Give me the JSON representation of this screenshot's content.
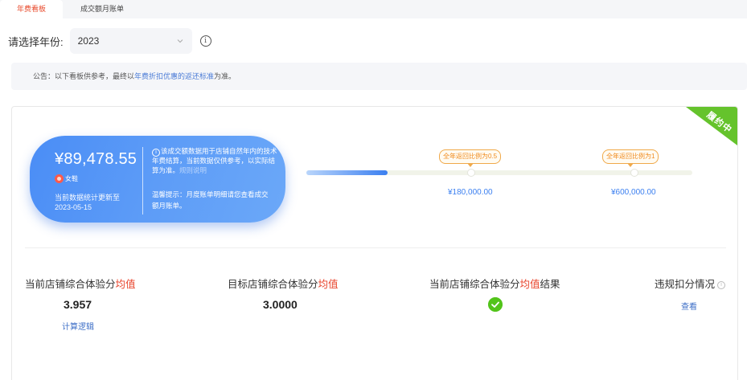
{
  "tabs": [
    {
      "label": "年费看板",
      "active": true
    },
    {
      "label": "成交额月账单",
      "active": false
    }
  ],
  "year_filter": {
    "label": "请选择年份:",
    "value": "2023"
  },
  "notice": {
    "prefix": "公告：以下看板供参考，最终以",
    "link": "年费折扣优惠的返还标准",
    "suffix": "为准。"
  },
  "status_ribbon": "履约中",
  "summary": {
    "amount": "¥89,478.55",
    "tier": "女鞋",
    "update_line1": "当前数据统计更新至",
    "update_line2": "2023-05-15",
    "desc_main": "该成交额数据用于店铺自然年内的技术年费结算，当前数据仅供参考，以实际结算为准。",
    "desc_dim": "规则说明",
    "tip": "温馨提示：月度账单明细请您查看成交额月账单。"
  },
  "progress": {
    "fill_fraction": 0.21,
    "milestones": [
      {
        "flag": "全年返回比例为0.5",
        "amount": "¥180,000.00"
      },
      {
        "flag": "全年返回比例为1",
        "amount": "¥600,000.00"
      }
    ]
  },
  "metrics": [
    {
      "title_prefix": "当前店铺综合体验分",
      "title_highlight": "均值",
      "title_suffix": "",
      "value": "3.957",
      "link": "计算逻辑"
    },
    {
      "title_prefix": "目标店铺综合体验分",
      "title_highlight": "均值",
      "title_suffix": "",
      "value": "3.0000"
    },
    {
      "title_prefix": "当前店铺综合体验分",
      "title_highlight": "均值",
      "title_suffix": "结果",
      "status": "pass"
    },
    {
      "title_prefix": "违规扣分情况",
      "title_highlight": "",
      "title_suffix": "",
      "link": "查看"
    }
  ],
  "colors": {
    "accent_red": "#e8432b",
    "link_blue": "#3e6fc7",
    "card_blue": "#4a8df6",
    "ribbon_green": "#65c32c",
    "pass_green": "#52c41a",
    "flag_orange": "#f08b1e"
  }
}
